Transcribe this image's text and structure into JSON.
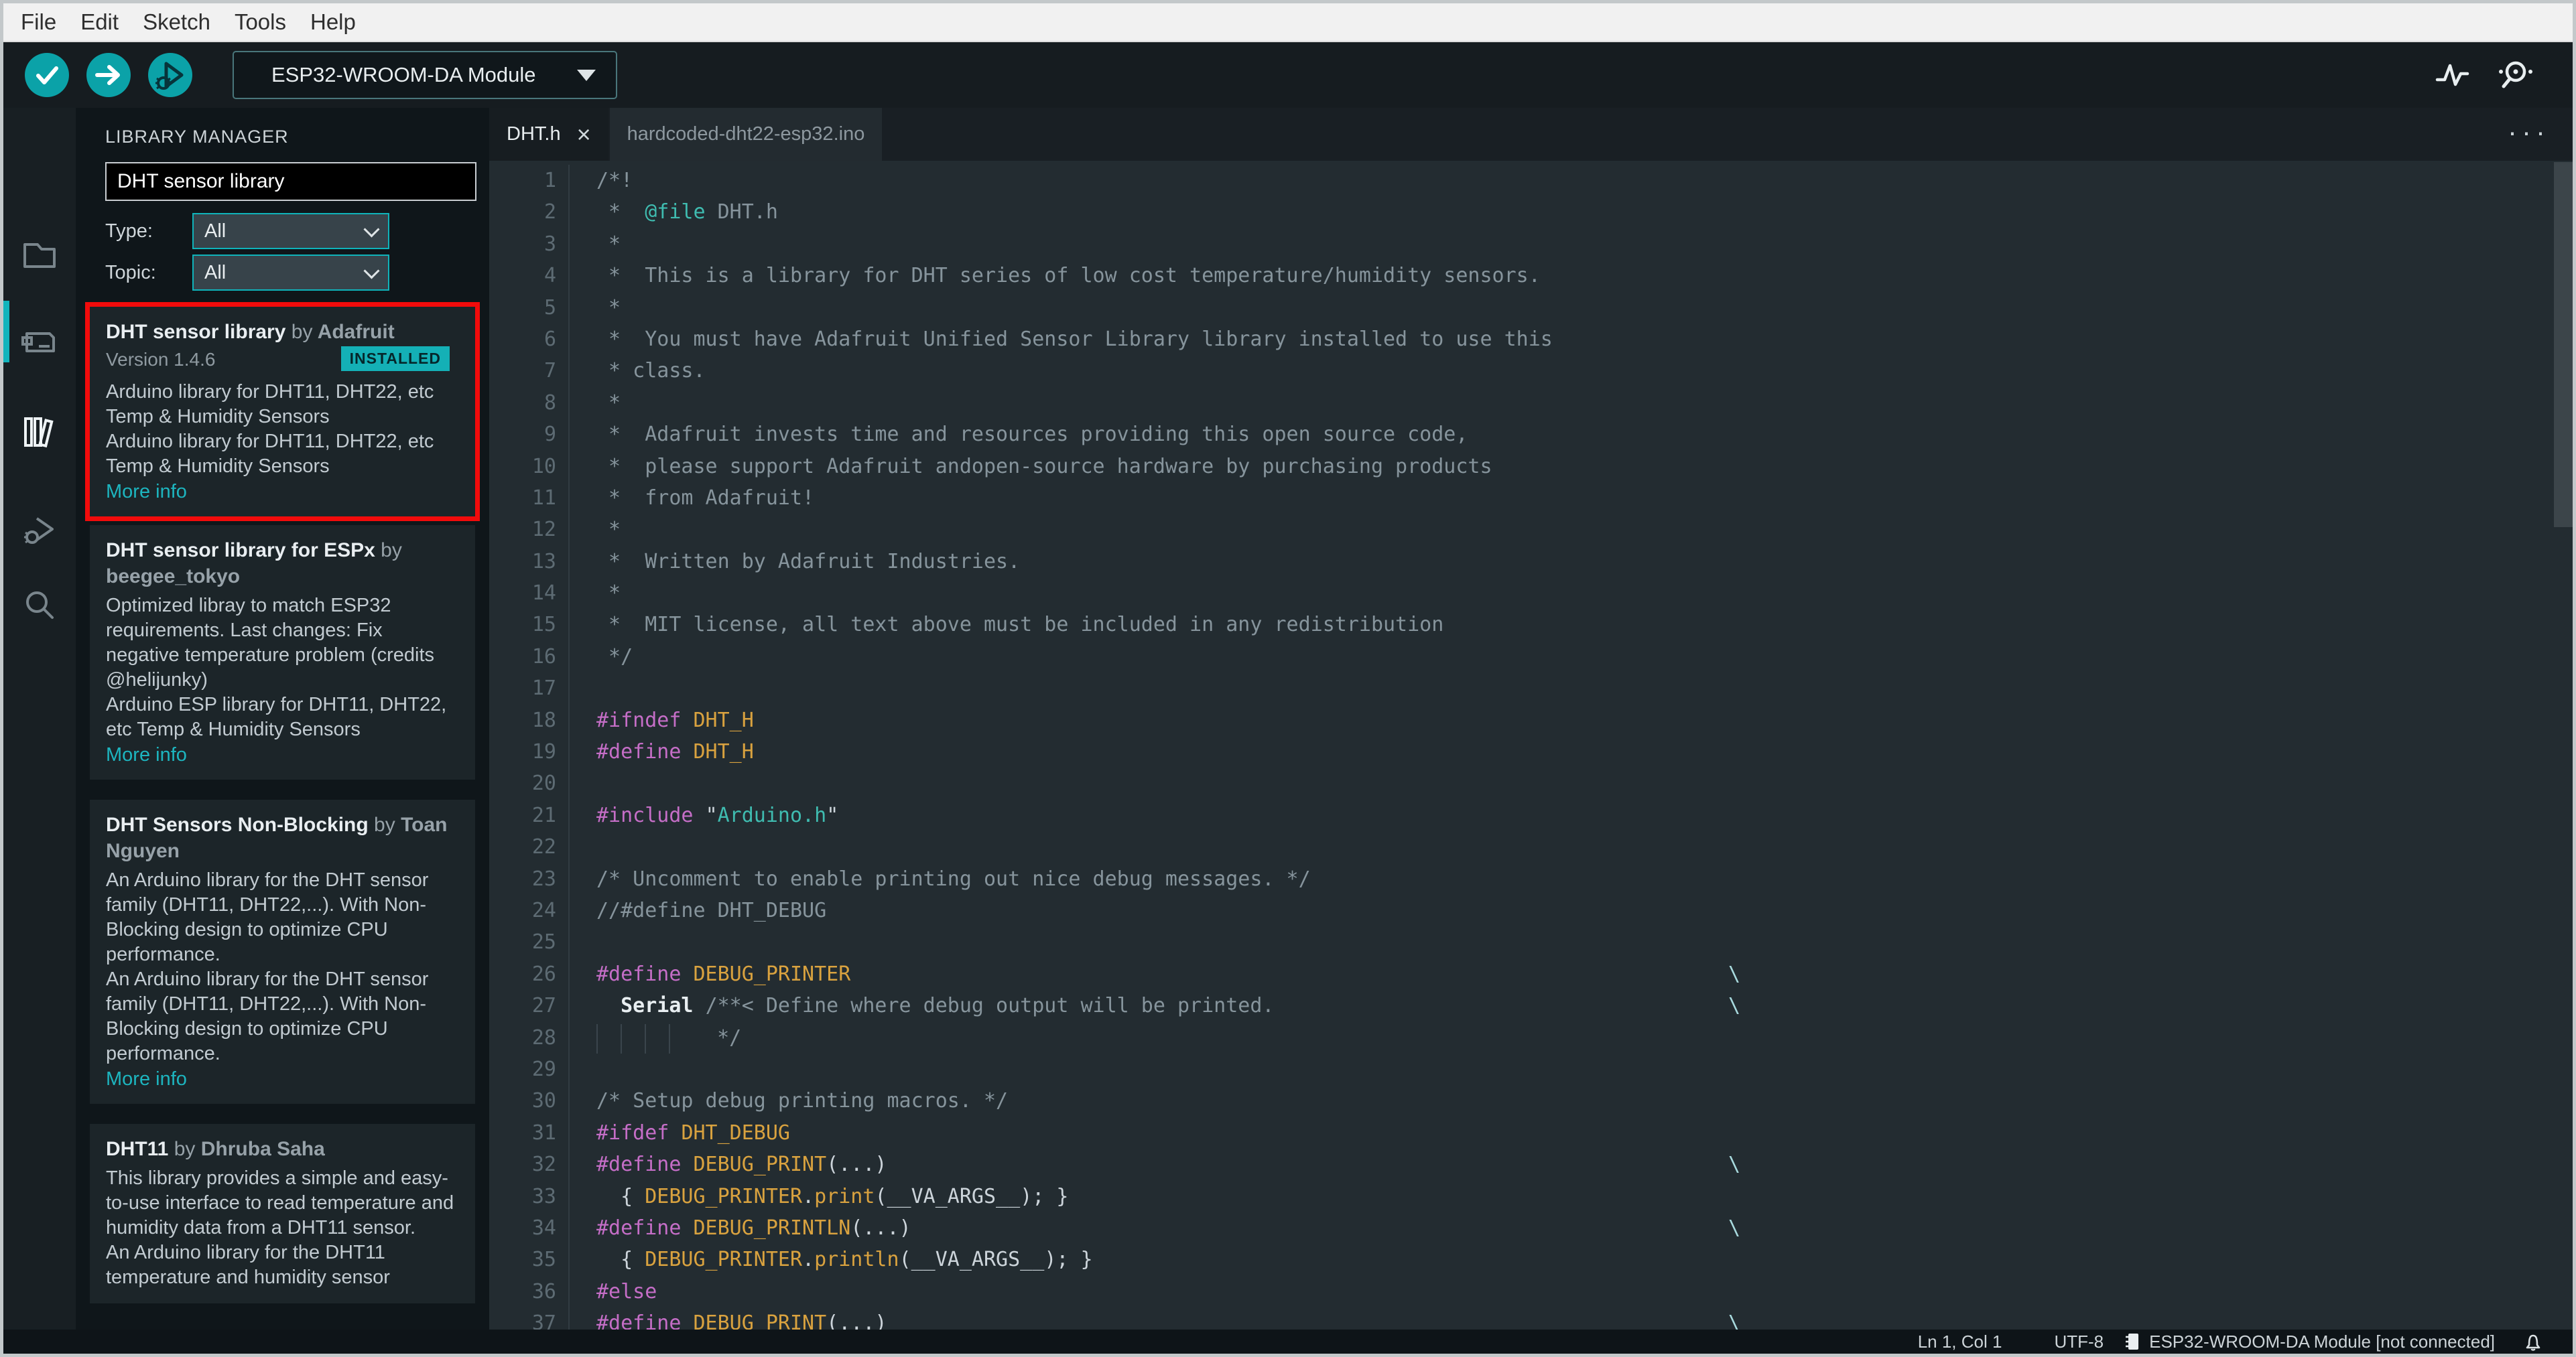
{
  "menu": {
    "items": [
      "File",
      "Edit",
      "Sketch",
      "Tools",
      "Help"
    ]
  },
  "toolbar": {
    "verify_label": "Verify",
    "upload_label": "Upload",
    "debug_label": "Start Debugging",
    "board_selector": "ESP32-WROOM-DA Module"
  },
  "sidebar": {
    "items": [
      "sketchbook",
      "boards-manager",
      "library-manager",
      "debug",
      "search"
    ],
    "active": "library-manager"
  },
  "library_manager": {
    "title": "LIBRARY MANAGER",
    "search_value": "DHT sensor library",
    "by_label": "by",
    "filters": [
      {
        "label": "Type:",
        "value": "All"
      },
      {
        "label": "Topic:",
        "value": "All"
      }
    ],
    "entries": [
      {
        "title": "DHT sensor library",
        "author": "Adafruit",
        "version": "Version 1.4.6",
        "badge": "INSTALLED",
        "description": [
          "Arduino library for DHT11, DHT22, etc Temp & Humidity Sensors",
          "Arduino library for DHT11, DHT22, etc Temp & Humidity Sensors"
        ],
        "link": "More info",
        "highlighted": true
      },
      {
        "title": "DHT sensor library for ESPx",
        "author": "beegee_tokyo",
        "description": [
          "Optimized libray to match ESP32 requirements. Last changes: Fix negative temperature problem (credits @helijunky)",
          "Arduino ESP library for DHT11, DHT22, etc Temp & Humidity Sensors"
        ],
        "link": "More info"
      },
      {
        "title": "DHT Sensors Non-Blocking",
        "author": "Toan Nguyen",
        "description": [
          "An Arduino library for the DHT sensor family (DHT11, DHT22,...). With Non-Blocking design to optimize CPU performance.",
          "An Arduino library for the DHT sensor family (DHT11, DHT22,...). With Non-Blocking design to optimize CPU performance."
        ],
        "link": "More info"
      },
      {
        "title": "DHT11",
        "author": "Dhruba Saha",
        "description": [
          "This library provides a simple and easy-to-use interface to read temperature and humidity data from a DHT11 sensor.",
          "An Arduino library for the DHT11 temperature and humidity sensor"
        ]
      }
    ]
  },
  "editor": {
    "tabs": [
      {
        "label": "DHT.h",
        "active": true
      },
      {
        "label": "hardcoded-dht22-esp32.ino",
        "active": false
      }
    ],
    "icons": {
      "tab_close": "×",
      "tab_overflow": "···"
    },
    "code": {
      "continuation_glyph": "\\",
      "lines": [
        {
          "n": 1,
          "s": [
            [
              "/*!",
              "c"
            ]
          ]
        },
        {
          "n": 2,
          "s": [
            [
              " *  ",
              "c"
            ],
            [
              "@file",
              "s"
            ],
            [
              " DHT.h",
              "c"
            ]
          ]
        },
        {
          "n": 3,
          "s": [
            [
              " *",
              "c"
            ]
          ]
        },
        {
          "n": 4,
          "s": [
            [
              " *  This is a library for DHT series of low cost temperature/humidity sensors.",
              "c"
            ]
          ]
        },
        {
          "n": 5,
          "s": [
            [
              " *",
              "c"
            ]
          ]
        },
        {
          "n": 6,
          "s": [
            [
              " *  You must have Adafruit Unified Sensor Library library installed to use this",
              "c"
            ]
          ]
        },
        {
          "n": 7,
          "s": [
            [
              " * class.",
              "c"
            ]
          ]
        },
        {
          "n": 8,
          "s": [
            [
              " *",
              "c"
            ]
          ]
        },
        {
          "n": 9,
          "s": [
            [
              " *  Adafruit invests time and resources providing this open source code,",
              "c"
            ]
          ]
        },
        {
          "n": 10,
          "s": [
            [
              " *  please support Adafruit andopen-source hardware by purchasing products",
              "c"
            ]
          ]
        },
        {
          "n": 11,
          "s": [
            [
              " *  from Adafruit!",
              "c"
            ]
          ]
        },
        {
          "n": 12,
          "s": [
            [
              " *",
              "c"
            ]
          ]
        },
        {
          "n": 13,
          "s": [
            [
              " *  Written by Adafruit Industries.",
              "c"
            ]
          ]
        },
        {
          "n": 14,
          "s": [
            [
              " *",
              "c"
            ]
          ]
        },
        {
          "n": 15,
          "s": [
            [
              " *  MIT license, all text above must be included in any redistribution",
              "c"
            ]
          ]
        },
        {
          "n": 16,
          "s": [
            [
              " */",
              "c"
            ]
          ]
        },
        {
          "n": 17,
          "s": []
        },
        {
          "n": 18,
          "s": [
            [
              "#ifndef ",
              "d"
            ],
            [
              "DHT_H",
              "m"
            ]
          ]
        },
        {
          "n": 19,
          "s": [
            [
              "#define ",
              "d"
            ],
            [
              "DHT_H",
              "m"
            ]
          ]
        },
        {
          "n": 20,
          "s": []
        },
        {
          "n": 21,
          "s": [
            [
              "#include ",
              "d"
            ],
            [
              "\"",
              "p"
            ],
            [
              "Arduino.h",
              "s"
            ],
            [
              "\"",
              "p"
            ]
          ]
        },
        {
          "n": 22,
          "s": []
        },
        {
          "n": 23,
          "s": [
            [
              "/* Uncomment to enable printing out nice debug messages. */",
              "c"
            ]
          ]
        },
        {
          "n": 24,
          "s": [
            [
              "//#define DHT_DEBUG",
              "c"
            ]
          ]
        },
        {
          "n": 25,
          "s": []
        },
        {
          "n": 26,
          "s": [
            [
              "#define ",
              "d"
            ],
            [
              "DEBUG_PRINTER",
              "m"
            ]
          ],
          "x": true
        },
        {
          "n": 27,
          "s": [
            [
              "  ",
              "p"
            ],
            [
              "Serial",
              "k"
            ],
            [
              " ",
              "p"
            ],
            [
              "/**< Define where debug output will be printed.",
              "c"
            ]
          ],
          "x": true
        },
        {
          "n": 28,
          "g": 4,
          "s": [
            [
              "  */",
              "c"
            ]
          ]
        },
        {
          "n": 29,
          "s": []
        },
        {
          "n": 30,
          "s": [
            [
              "/* Setup debug printing macros. */",
              "c"
            ]
          ]
        },
        {
          "n": 31,
          "s": [
            [
              "#ifdef ",
              "d"
            ],
            [
              "DHT_DEBUG",
              "m"
            ]
          ]
        },
        {
          "n": 32,
          "s": [
            [
              "#define ",
              "d"
            ],
            [
              "DEBUG_PRINT",
              "m"
            ],
            [
              "(...)",
              "p"
            ]
          ],
          "x": true
        },
        {
          "n": 33,
          "s": [
            [
              "  { ",
              "p"
            ],
            [
              "DEBUG_PRINTER",
              "m"
            ],
            [
              ".",
              "p"
            ],
            [
              "print",
              "m"
            ],
            [
              "(",
              "p"
            ],
            [
              "__VA_ARGS__",
              "p"
            ],
            [
              "); }",
              "p"
            ]
          ]
        },
        {
          "n": 34,
          "s": [
            [
              "#define ",
              "d"
            ],
            [
              "DEBUG_PRINTLN",
              "m"
            ],
            [
              "(...)",
              "p"
            ]
          ],
          "x": true
        },
        {
          "n": 35,
          "s": [
            [
              "  { ",
              "p"
            ],
            [
              "DEBUG_PRINTER",
              "m"
            ],
            [
              ".",
              "p"
            ],
            [
              "println",
              "m"
            ],
            [
              "(",
              "p"
            ],
            [
              "__VA_ARGS__",
              "p"
            ],
            [
              "); }",
              "p"
            ]
          ]
        },
        {
          "n": 36,
          "s": [
            [
              "#else",
              "d"
            ]
          ]
        },
        {
          "n": 37,
          "s": [
            [
              "#define ",
              "d"
            ],
            [
              "DEBUG_PRINT",
              "m"
            ],
            [
              "(...)",
              "p"
            ]
          ],
          "x": true
        }
      ]
    }
  },
  "status_bar": {
    "cursor_position": "Ln 1, Col 1",
    "encoding": "UTF-8",
    "board_status": "ESP32-WROOM-DA Module [not connected]"
  },
  "colors": {
    "accent_teal": "#12b1b8",
    "highlight_red": "#f20b0b",
    "installed_badge_bg": "#14b0b6",
    "editor_bg": "#232c31",
    "syntax": {
      "comment": "#86949c",
      "directive": "#c56ec7",
      "macro": "#d9a23f",
      "string": "#3fbcb0",
      "plain": "#ccd4da",
      "keyword": "#e8eef1",
      "continuation": "#a8dade"
    }
  }
}
